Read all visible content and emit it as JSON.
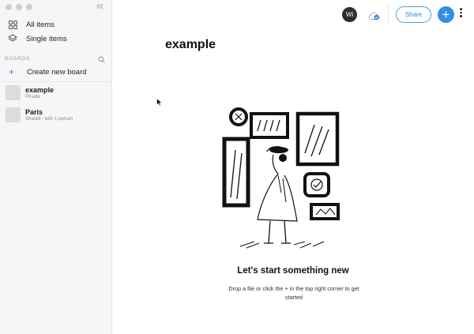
{
  "sidebar": {
    "collapse_icon": "chevrons-left-icon",
    "nav": [
      {
        "label": "All items",
        "icon": "grid-icon"
      },
      {
        "label": "Single items",
        "icon": "layers-icon"
      }
    ],
    "boards_section_label": "BOARDS",
    "create_board_label": "Create new board",
    "boards": [
      {
        "name": "example",
        "sub": "Private"
      },
      {
        "name": "Paris",
        "sub": "Shared - with 1 person"
      }
    ]
  },
  "topbar": {
    "avatar_initials": "Wi",
    "share_label": "Share",
    "add_label": "+"
  },
  "main": {
    "title": "example",
    "empty_title": "Let's start something new",
    "empty_subtitle": "Drop a file or click the + in the top right corner to get started"
  },
  "colors": {
    "accent": "#2f8fe3",
    "sidebar_bg": "#f6f6f6"
  }
}
